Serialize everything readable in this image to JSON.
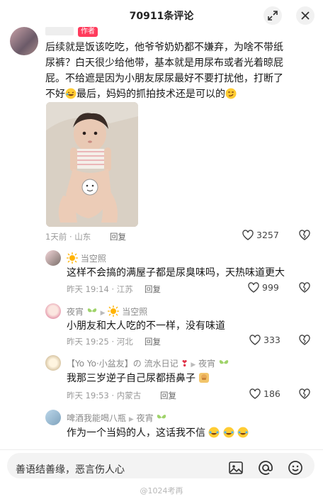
{
  "header": {
    "title": "70911条评论"
  },
  "main_comment": {
    "author_tag": "作者",
    "text_line1": "后续就是饭该吃吃，他爷爷奶奶都不嫌弃，为啥不带纸",
    "text_line2": "尿裤？白天很少给他带，基本就是用尿布或者光着晾屁",
    "text_line3": "屁。不给遮是因为小朋友尿尿最好不要打扰他，打断了",
    "text_line4a": "不好",
    "text_line4b": "最后，妈妈的抓拍技术还是可以的",
    "meta": "1天前 · 山东",
    "reply_label": "回复",
    "likes": "3257"
  },
  "replies": [
    {
      "username": "当空照",
      "text": "这样不会搞的满屋子都是尿臭味吗，天热味道更大",
      "meta": "昨天 19:14 · 江苏",
      "reply_label": "回复",
      "likes": "999"
    },
    {
      "username": "夜宵",
      "reply_to": "当空照",
      "text": "小朋友和大人吃的不一样，没有味道",
      "meta": "昨天 19:25 · 河北",
      "reply_label": "回复",
      "likes": "333"
    },
    {
      "username": "【Yo Yo·小盆友】の 流水日记",
      "reply_to": "夜宵",
      "text": "我那三岁逆子自己尿都捂鼻子",
      "meta": "昨天 19:53 · 内蒙古",
      "reply_label": "回复",
      "likes": "186"
    },
    {
      "username": "啤酒我能喝八瓶",
      "reply_to": "夜宵",
      "text": "作为一个当妈的人，这话我不信"
    }
  ],
  "input": {
    "placeholder": "善语结善缘，恶言伤人心"
  },
  "watermark": "@1024考再",
  "colors": {
    "author_tag": "#ff3b5c",
    "text": "#161616",
    "meta": "#9a9a9a"
  }
}
